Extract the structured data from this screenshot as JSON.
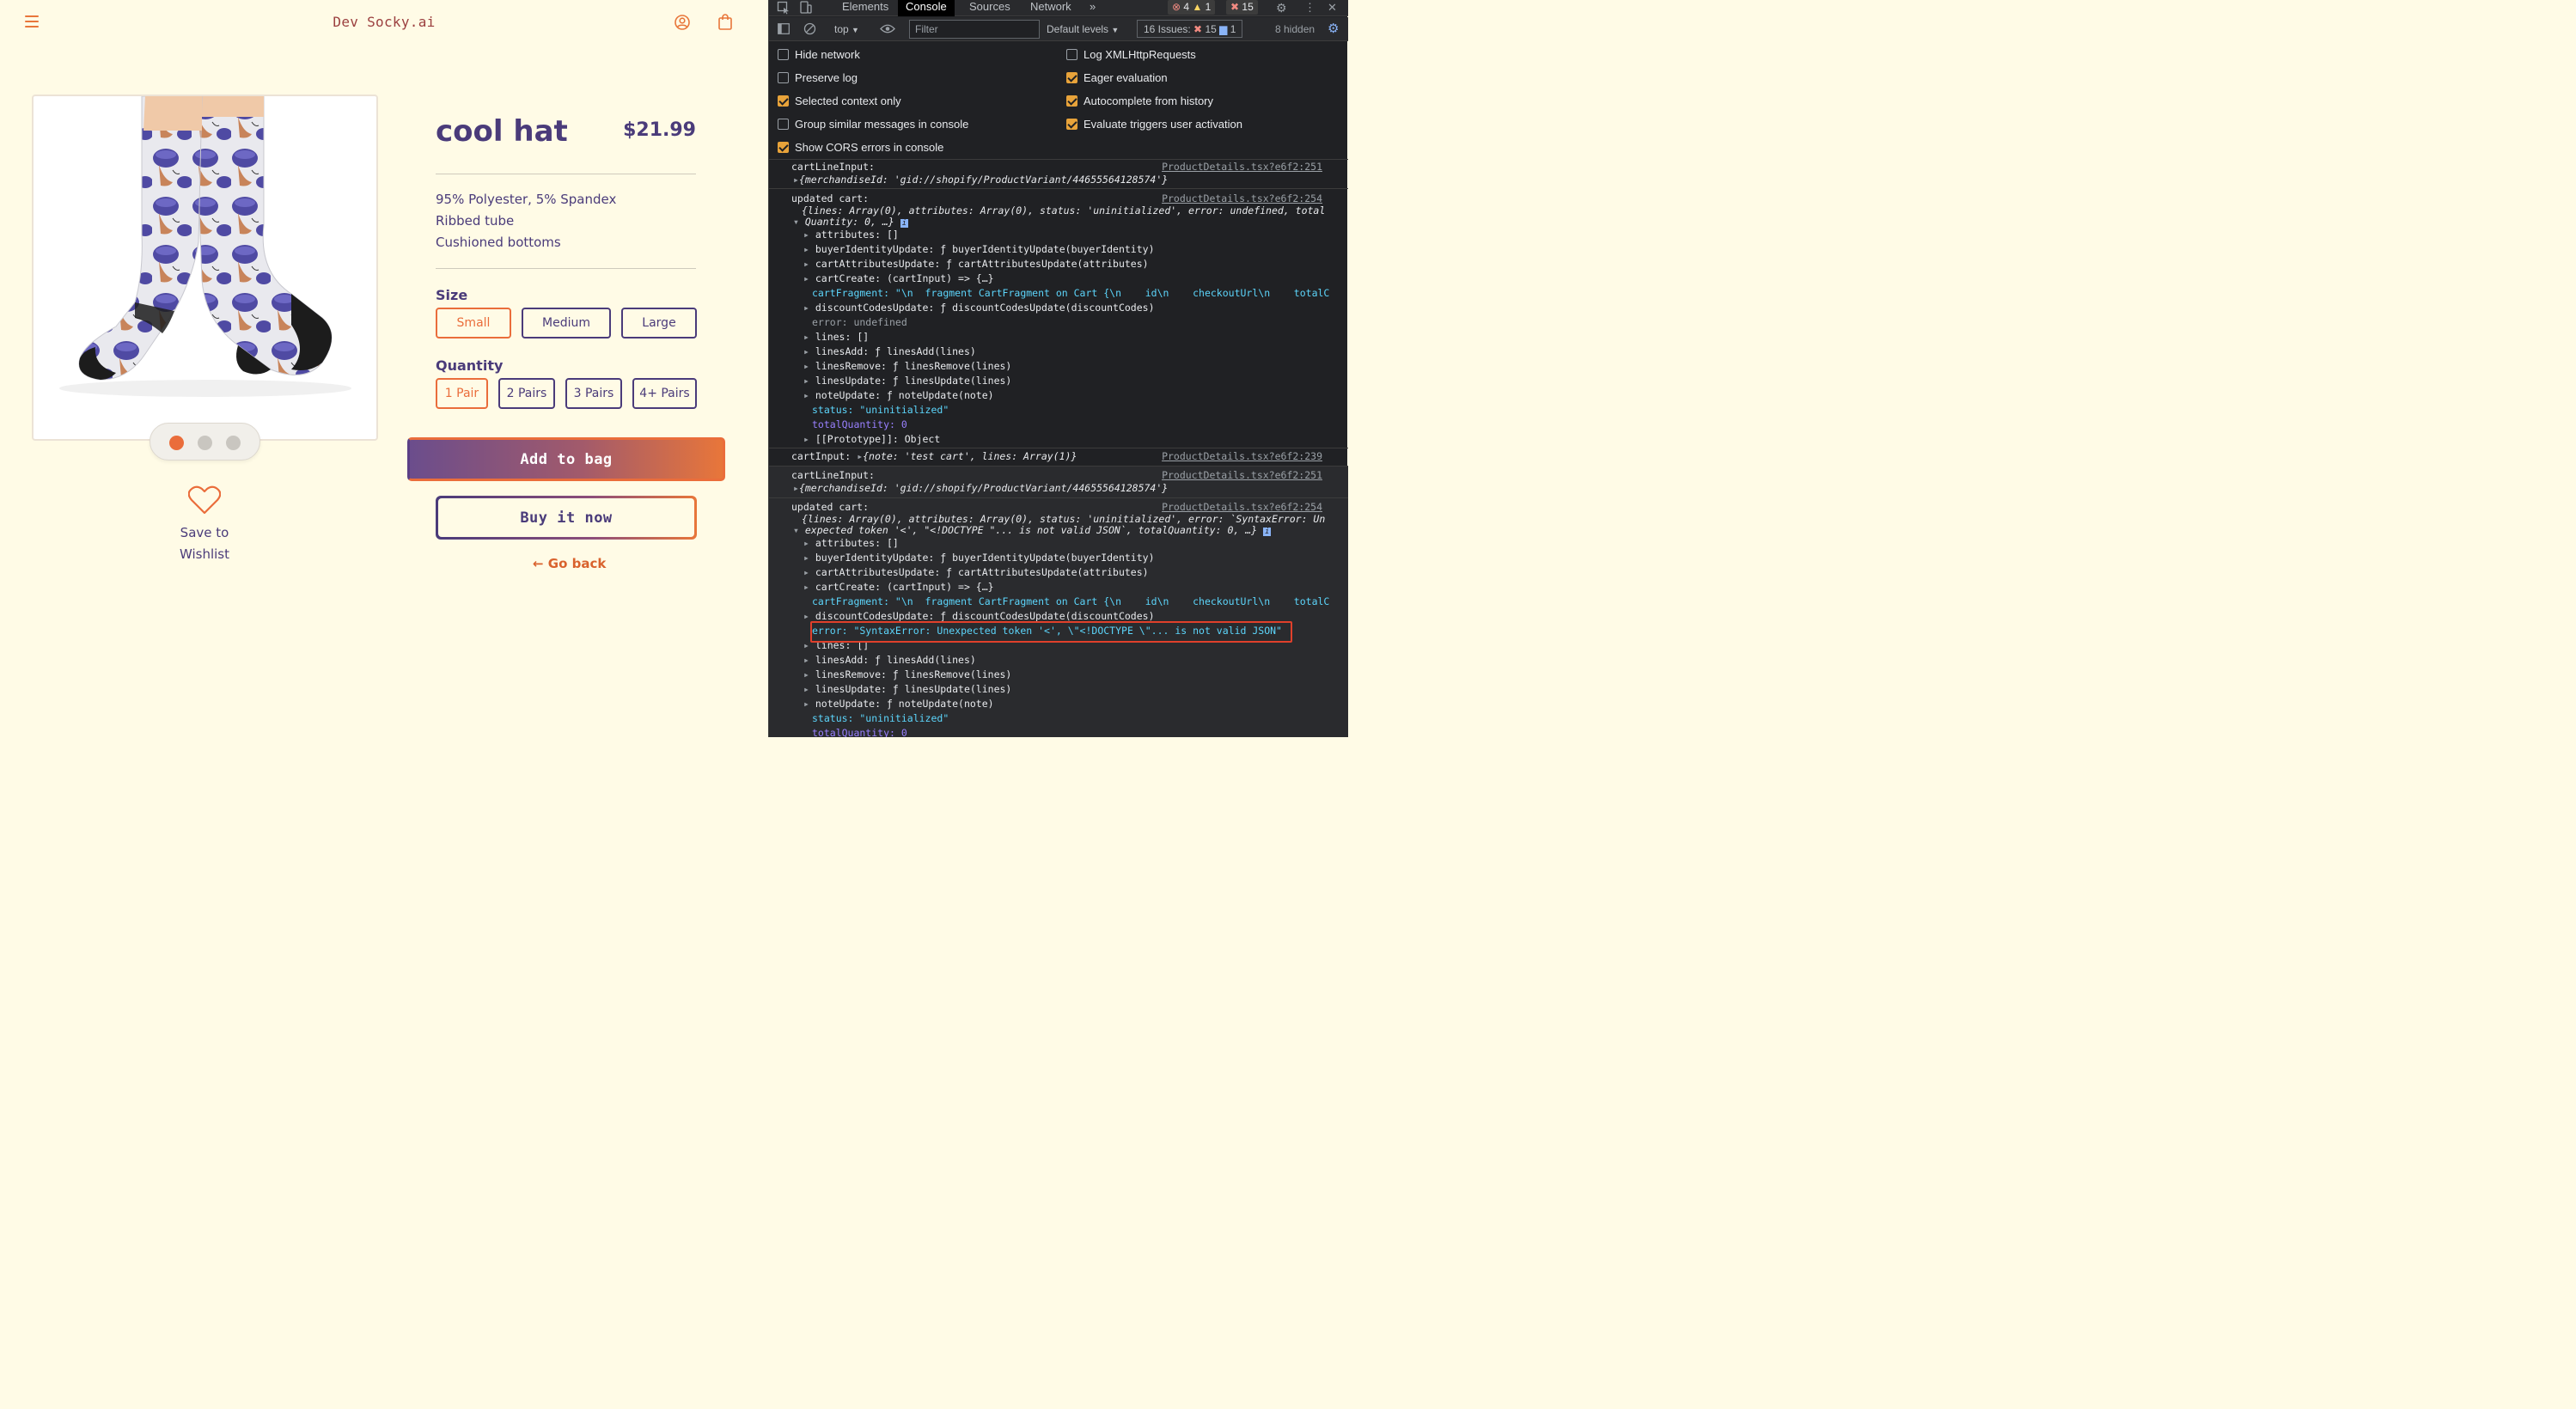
{
  "store": {
    "brand": "Dev Socky.ai",
    "product": {
      "title": "cool hat",
      "price": "$21.99",
      "description": [
        "95% Polyester, 5% Spandex",
        "Ribbed tube",
        "Cushioned bottoms"
      ]
    },
    "size": {
      "label": "Size",
      "options": [
        "Small",
        "Medium",
        "Large"
      ],
      "selected": "Small"
    },
    "quantity": {
      "label": "Quantity",
      "options": [
        "1 Pair",
        "2 Pairs",
        "3 Pairs",
        "4+ Pairs"
      ],
      "selected": "1 Pair"
    },
    "carousel": {
      "count": 3,
      "active": 0
    },
    "buttons": {
      "add_to_bag": "Add to bag",
      "buy_now": "Buy it now",
      "go_back": "← Go back"
    },
    "wishlist": {
      "line1": "Save to",
      "line2": "Wishlist"
    },
    "colors": {
      "accent": "#ea6d3b",
      "brand_purple": "#4a3b7a",
      "background": "#fffbe6"
    }
  },
  "devtools": {
    "tabs": [
      "Elements",
      "Console",
      "Sources",
      "Network"
    ],
    "active_tab": "Console",
    "more_tabs": "»",
    "badges": {
      "errors": "4",
      "warnings": "1",
      "issues": "15"
    },
    "toolbar": {
      "context": "top",
      "filter_placeholder": "Filter",
      "levels": "Default levels",
      "issues_label": "16 Issues:",
      "issues_errors": "15",
      "issues_info": "1",
      "hidden": "8 hidden"
    },
    "settings_left": [
      {
        "label": "Hide network",
        "checked": false
      },
      {
        "label": "Preserve log",
        "checked": false
      },
      {
        "label": "Selected context only",
        "checked": true
      },
      {
        "label": "Group similar messages in console",
        "checked": false
      },
      {
        "label": "Show CORS errors in console",
        "checked": true
      }
    ],
    "settings_right": [
      {
        "label": "Log XMLHttpRequests",
        "checked": false
      },
      {
        "label": "Eager evaluation",
        "checked": true
      },
      {
        "label": "Autocomplete from history",
        "checked": true
      },
      {
        "label": "Evaluate triggers user activation",
        "checked": true
      }
    ],
    "sources": {
      "s1": "ProductDetails.tsx?e6f2:251",
      "s2": "ProductDetails.tsx?e6f2:254",
      "s3": "ProductDetails.tsx?e6f2:239",
      "s4": "ProductDetails.tsx?e6f2:251",
      "s5": "ProductDetails.tsx?e6f2:254"
    },
    "log": {
      "cart_line_input": "cartLineInput:",
      "merchandise": "{merchandiseId: 'gid://shopify/ProductVariant/44655564128574'}",
      "updated_cart": "updated cart:",
      "summary1_a": "{lines: Array(0), attributes: Array(0), status: 'uninitialized', error: undefined, total",
      "summary1_b": "Quantity: 0, …}",
      "cart_input": "cartInput:",
      "cart_input_val": "{note: 'test cart', lines: Array(1)}",
      "summary2_a": "{lines: Array(0), attributes: Array(0), status: 'uninitialized', error: `SyntaxError: Un",
      "summary2_b": "expected token '<', \"<!DOCTYPE \"... is not valid JSON`, totalQuantity: 0, …}",
      "error_line": "error: \"SyntaxError: Unexpected token '<', \\\"<!DOCTYPE \\\"... is not valid JSON\""
    },
    "props": {
      "attributes": "attributes: []",
      "buyerIdentityUpdate": "buyerIdentityUpdate: ƒ buyerIdentityUpdate(buyerIdentity)",
      "cartAttributesUpdate": "cartAttributesUpdate: ƒ cartAttributesUpdate(attributes)",
      "cartCreate": "cartCreate: (cartInput) => {…}",
      "cartFragment": "cartFragment: \"\\n  fragment CartFragment on Cart {\\n    id\\n    checkoutUrl\\n    totalC",
      "discountCodesUpdate": "discountCodesUpdate: ƒ discountCodesUpdate(discountCodes)",
      "error_undefined": "error: undefined",
      "lines": "lines: []",
      "linesAdd": "linesAdd: ƒ linesAdd(lines)",
      "linesRemove": "linesRemove: ƒ linesRemove(lines)",
      "linesUpdate": "linesUpdate: ƒ linesUpdate(lines)",
      "noteUpdate": "noteUpdate: ƒ noteUpdate(note)",
      "status": "status: \"uninitialized\"",
      "totalQuantity": "totalQuantity: 0",
      "prototype": "[[Prototype]]: Object"
    }
  }
}
